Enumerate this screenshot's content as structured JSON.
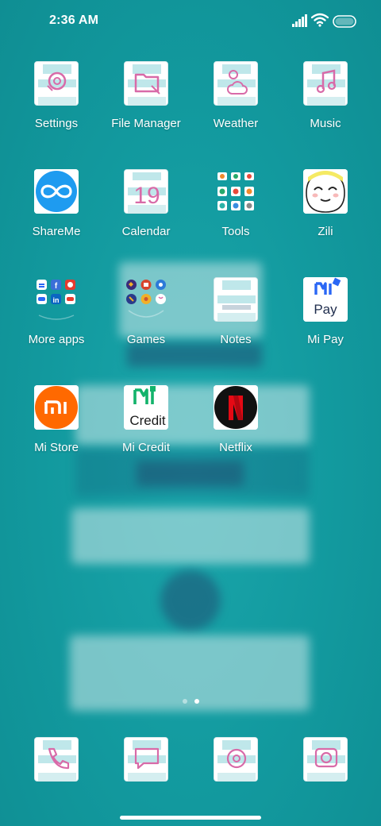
{
  "status_bar": {
    "time": "2:36 AM",
    "icons": [
      "signal-icon",
      "wifi-icon",
      "battery-icon"
    ]
  },
  "home": {
    "apps": [
      {
        "label": "Settings",
        "icon": "settings-icon"
      },
      {
        "label": "File Manager",
        "icon": "file-manager-icon"
      },
      {
        "label": "Weather",
        "icon": "weather-icon"
      },
      {
        "label": "Music",
        "icon": "music-icon"
      },
      {
        "label": "ShareMe",
        "icon": "shareme-icon"
      },
      {
        "label": "Calendar",
        "icon": "calendar-icon"
      },
      {
        "label": "Tools",
        "icon": "tools-folder-icon"
      },
      {
        "label": "Zili",
        "icon": "zili-icon"
      },
      {
        "label": "More apps",
        "icon": "more-apps-folder-icon"
      },
      {
        "label": "Games",
        "icon": "games-folder-icon"
      },
      {
        "label": "Notes",
        "icon": "notes-icon"
      },
      {
        "label": "Mi Pay",
        "icon": "mi-pay-icon"
      },
      {
        "label": "Mi Store",
        "icon": "mi-store-icon"
      },
      {
        "label": "Mi Credit",
        "icon": "mi-credit-icon"
      },
      {
        "label": "Netflix",
        "icon": "netflix-icon"
      }
    ],
    "calendar_day": "19",
    "mi_pay_text": "Pay",
    "mi_credit_text": "Credit",
    "page_count": 2,
    "current_page": 2
  },
  "dock": {
    "apps": [
      {
        "icon": "phone-icon"
      },
      {
        "icon": "messages-icon"
      },
      {
        "icon": "browser-icon"
      },
      {
        "icon": "camera-icon"
      }
    ]
  },
  "colors": {
    "wallpaper": "#12999e",
    "shareme": "#1e9bf0",
    "mi_store": "#ff6900",
    "mi_pay": "#2a67f5",
    "mi_credit": "#13b36b",
    "netflix": "#e50914"
  }
}
